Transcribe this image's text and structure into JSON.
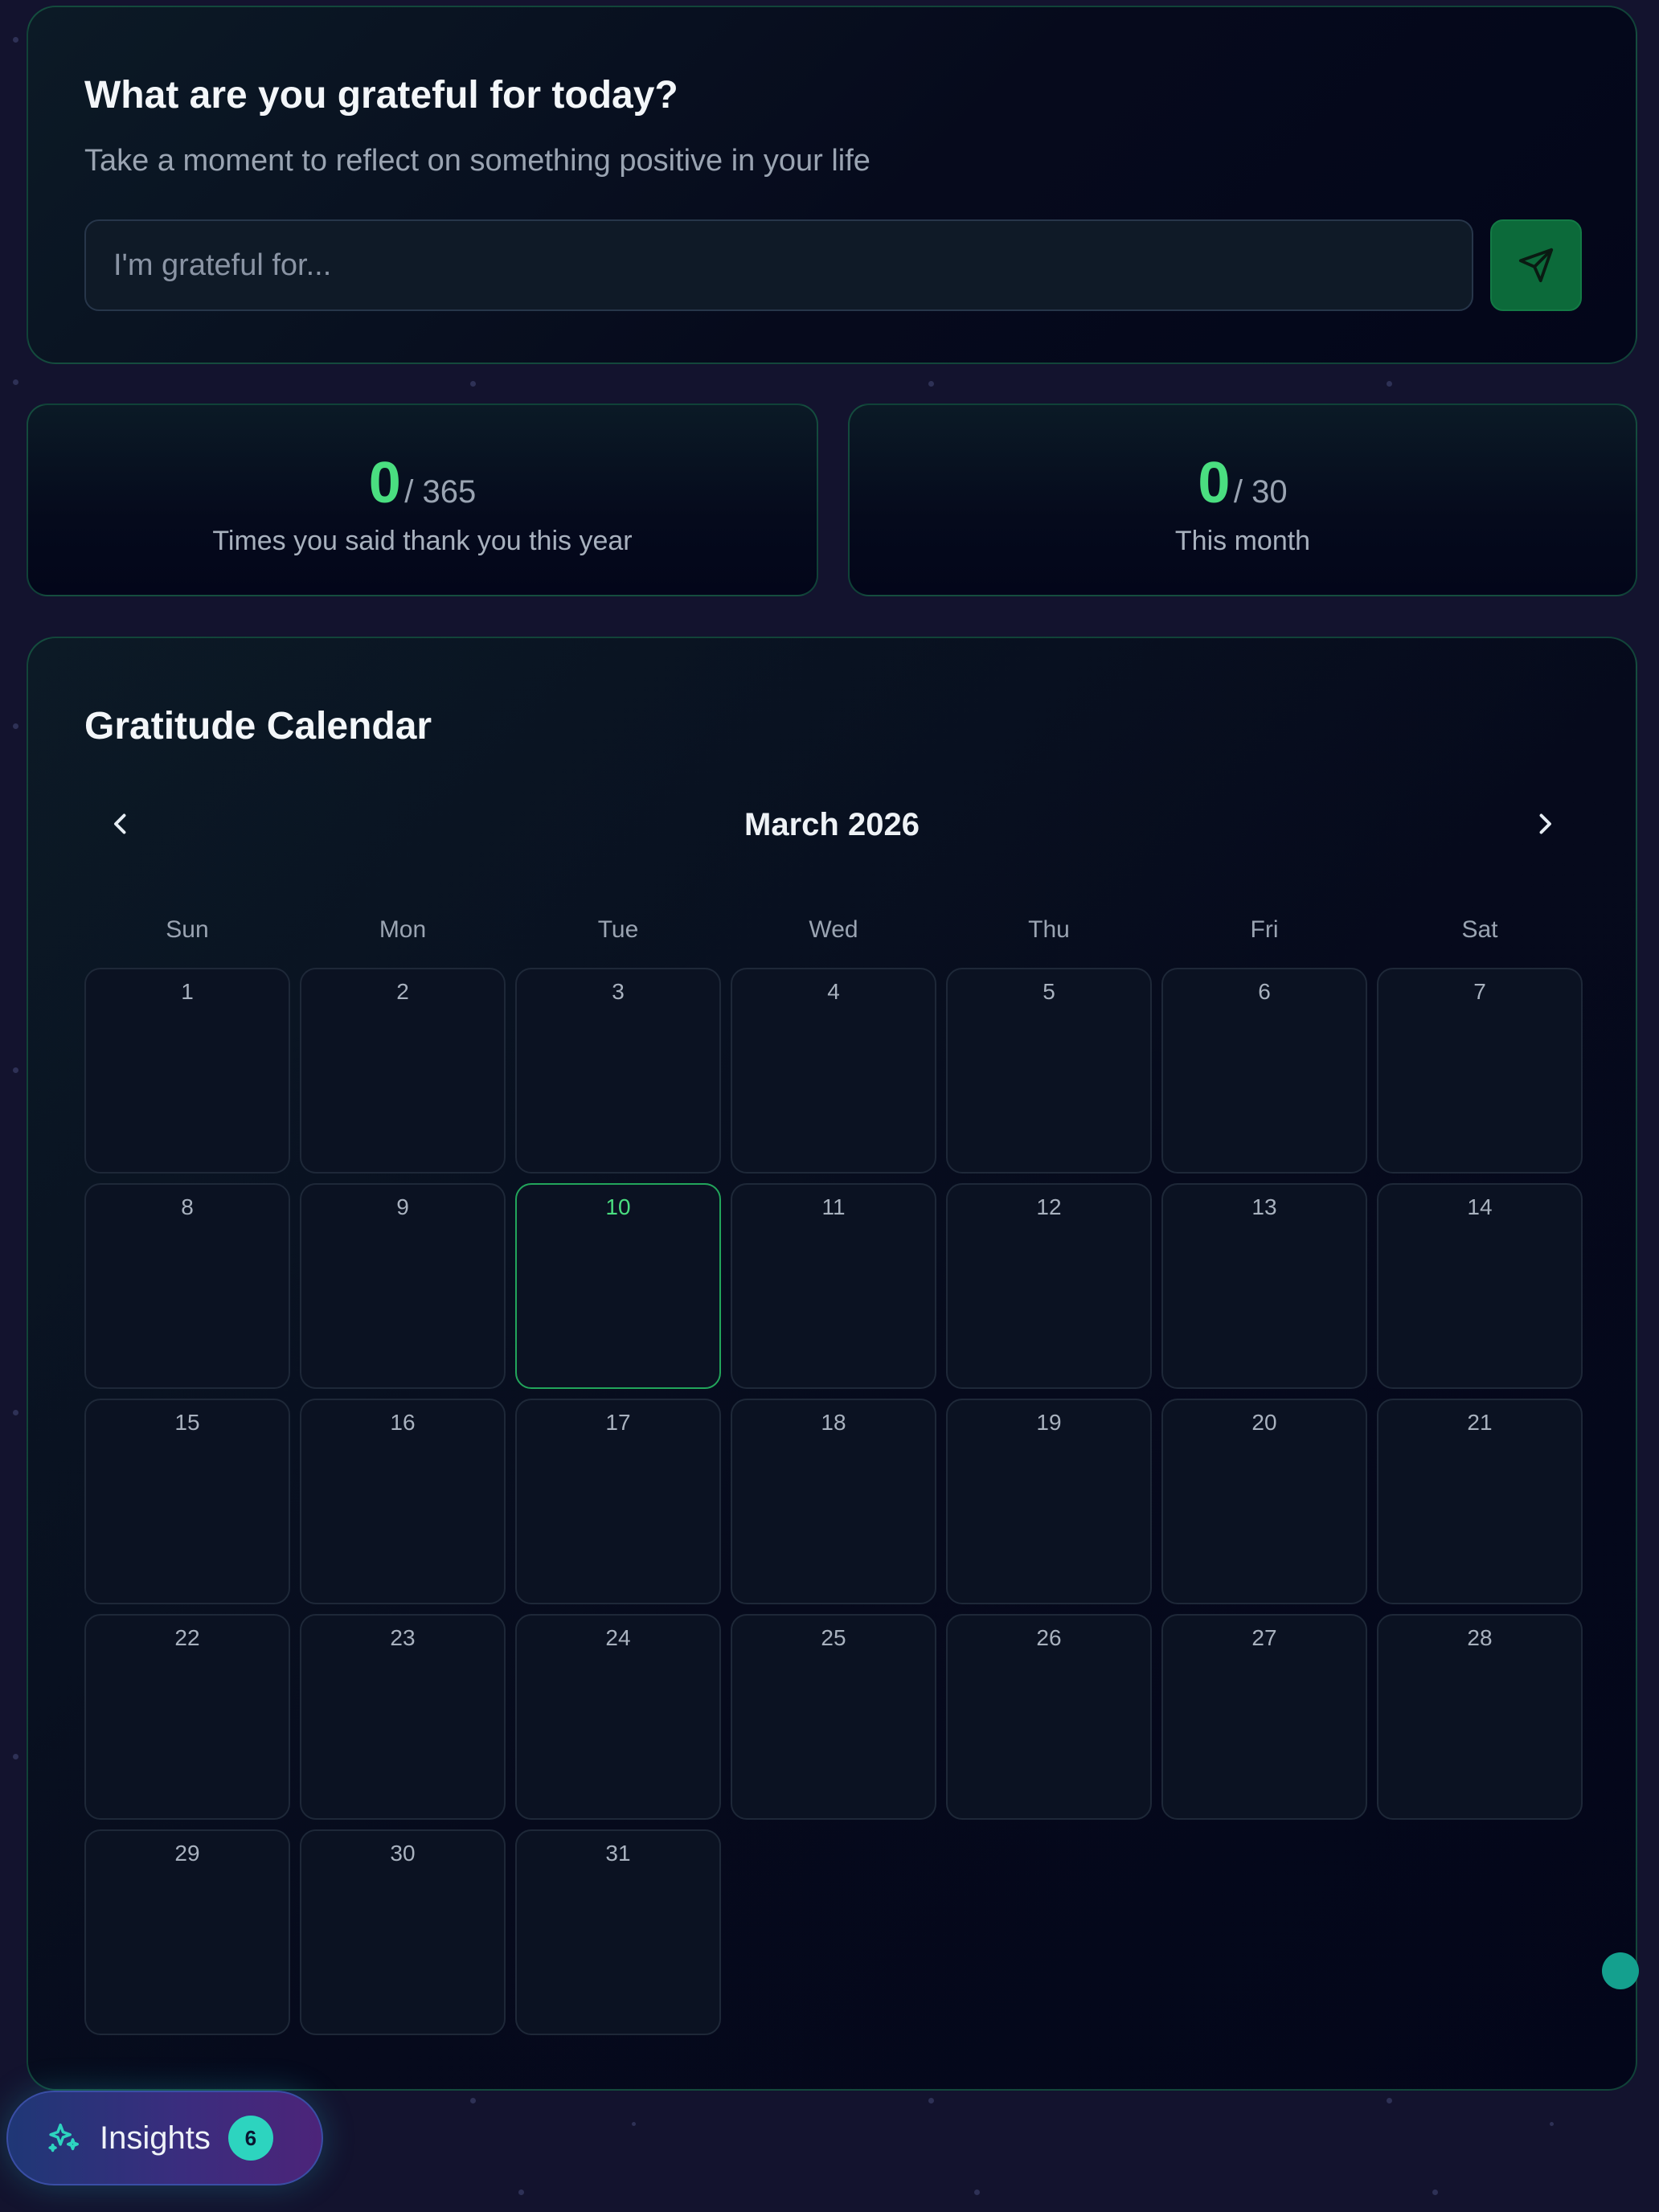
{
  "gratitude": {
    "title": "What are you grateful for today?",
    "subtitle": "Take a moment to reflect on something positive in your life",
    "input_placeholder": "I'm grateful for...",
    "input_value": "",
    "send_icon": "send-icon"
  },
  "stats": {
    "year": {
      "count": "0",
      "total": "/ 365",
      "label": "Times you said thank you this year"
    },
    "month": {
      "count": "0",
      "total": "/ 30",
      "label": "This month"
    }
  },
  "calendar": {
    "title": "Gratitude Calendar",
    "month_label": "March 2026",
    "prev_icon": "chevron-left-icon",
    "next_icon": "chevron-right-icon",
    "weekdays": [
      "Sun",
      "Mon",
      "Tue",
      "Wed",
      "Thu",
      "Fri",
      "Sat"
    ],
    "days": [
      "1",
      "2",
      "3",
      "4",
      "5",
      "6",
      "7",
      "8",
      "9",
      "10",
      "11",
      "12",
      "13",
      "14",
      "15",
      "16",
      "17",
      "18",
      "19",
      "20",
      "21",
      "22",
      "23",
      "24",
      "25",
      "26",
      "27",
      "28",
      "29",
      "30",
      "31"
    ],
    "today": "10"
  },
  "insights": {
    "label": "Insights",
    "badge": "6",
    "icon": "sparkles-icon"
  },
  "colors": {
    "accent_green": "#4ade80",
    "send_button": "#0c6a3a",
    "badge_teal": "#2dd4bf",
    "background": "#13132e"
  }
}
